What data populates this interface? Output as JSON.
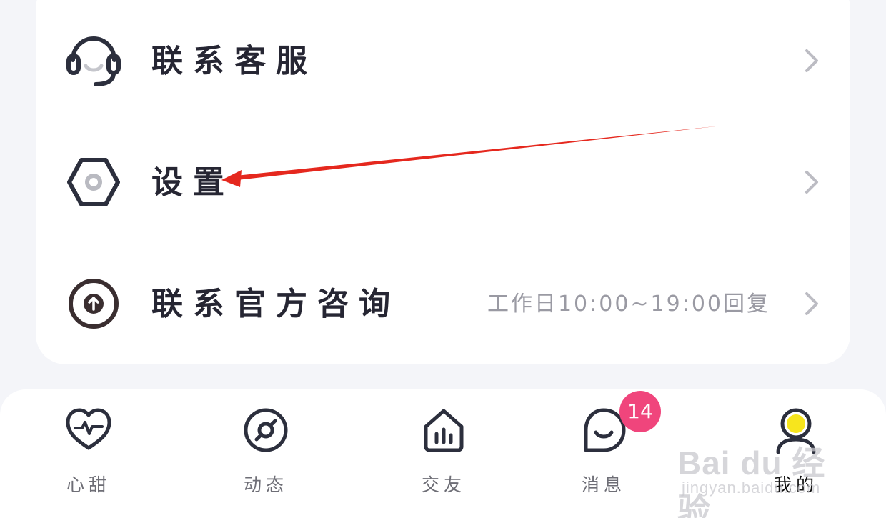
{
  "menu": {
    "items": [
      {
        "label": "联系客服",
        "icon": "headset-icon",
        "hint": ""
      },
      {
        "label": "设置",
        "icon": "settings-hexagon-icon",
        "hint": ""
      },
      {
        "label": "联系官方咨询",
        "icon": "arrow-up-circle-icon",
        "hint": "工作日10:00~19:00回复"
      }
    ]
  },
  "tabbar": {
    "tabs": [
      {
        "label": "心甜",
        "icon": "heart-pulse-icon"
      },
      {
        "label": "动态",
        "icon": "compass-icon"
      },
      {
        "label": "交友",
        "icon": "home-chart-icon"
      },
      {
        "label": "消息",
        "icon": "chat-smile-icon",
        "badge": "14"
      },
      {
        "label": "我的",
        "icon": "profile-icon",
        "active": true
      }
    ]
  },
  "watermark": {
    "logo": "Bai du 经验",
    "url": "jingyan.baidu.com"
  },
  "colors": {
    "background": "#f4f5f9",
    "card": "#ffffff",
    "icon_stroke": "#2c2f3d",
    "badge": "#f0457c",
    "annotation_arrow": "#e5281e",
    "profile_accent": "#f7e51d"
  }
}
